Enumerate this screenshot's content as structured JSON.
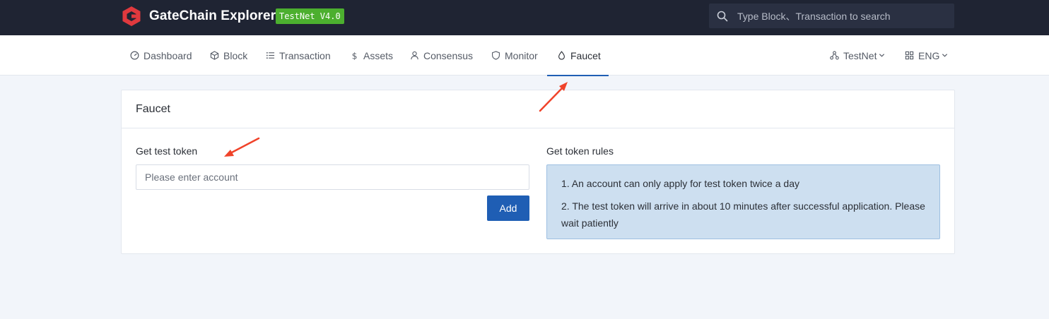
{
  "header": {
    "brand": "GateChain Explorer",
    "network_badge": "TestNet V4.0",
    "search_placeholder": "Type Block、Transaction to search",
    "colors": {
      "background": "#1f2433",
      "badge": "#4caf2f",
      "logo": "#e0393e"
    }
  },
  "nav": {
    "items": [
      {
        "label": "Dashboard",
        "icon": "dashboard-icon"
      },
      {
        "label": "Block",
        "icon": "cube-icon"
      },
      {
        "label": "Transaction",
        "icon": "list-icon"
      },
      {
        "label": "Assets",
        "icon": "dollar-icon"
      },
      {
        "label": "Consensus",
        "icon": "user-icon"
      },
      {
        "label": "Monitor",
        "icon": "shield-icon"
      },
      {
        "label": "Faucet",
        "icon": "drop-icon",
        "active": true
      }
    ],
    "network_selector": "TestNet",
    "language_selector": "ENG",
    "accent_color": "#1f5eb4"
  },
  "faucet": {
    "title": "Faucet",
    "get_token_label": "Get test token",
    "account_placeholder": "Please enter account",
    "add_button": "Add",
    "rules_title": "Get token rules",
    "rules": [
      "1.  An account can only apply for test token twice a day",
      "2. The test token will arrive in about 10 minutes after successful application. Please wait patiently"
    ]
  },
  "annotations": {
    "arrow_color": "#f0432a"
  }
}
